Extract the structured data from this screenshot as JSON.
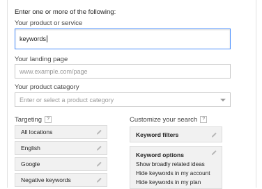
{
  "intro": "Enter one or more of the following:",
  "product": {
    "label": "Your product or service",
    "value": "keywords"
  },
  "landing": {
    "label": "Your landing page",
    "placeholder": "www.example.com/page"
  },
  "category": {
    "label": "Your product category",
    "placeholder": "Enter or select a product category"
  },
  "targeting": {
    "label": "Targeting",
    "help": "?",
    "items": [
      "All locations",
      "English",
      "Google",
      "Negative keywords"
    ]
  },
  "customize": {
    "label": "Customize your search",
    "help": "?",
    "filters_label": "Keyword filters",
    "options_label": "Keyword options",
    "options": [
      "Show broadly related ideas",
      "Hide keywords in my account",
      "Hide keywords in my plan"
    ]
  },
  "icons": {
    "edit": "pencil-icon",
    "help": "help-icon",
    "dropdown": "chevron-down-icon"
  }
}
